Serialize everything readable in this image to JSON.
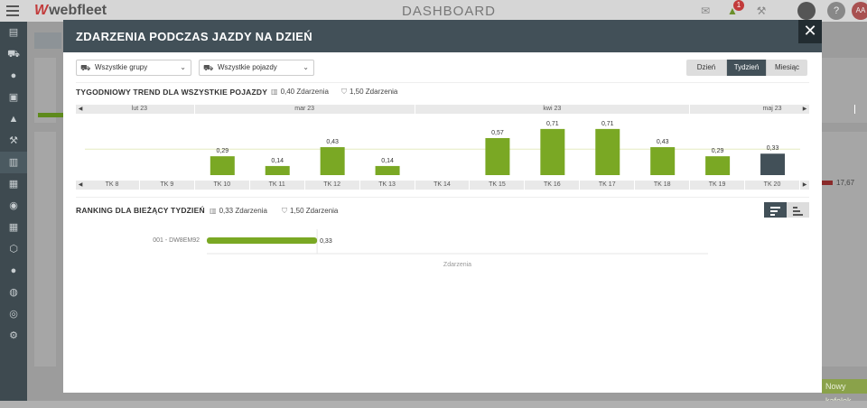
{
  "app": {
    "logo_text": "webfleet",
    "title": "DASHBOARD",
    "alert_count": "1",
    "avatar_initials": "AA",
    "help_label": "?"
  },
  "background": {
    "values": {
      "bg_val": "17,67"
    },
    "buttons": {
      "add_tile": "Nowy kafelek"
    }
  },
  "modal": {
    "title": "ZDARZENIA PODCZAS JAZDY NA DZIEŃ",
    "close_label": "✕",
    "filters": {
      "groups": "Wszystkie grupy",
      "vehicles": "Wszystkie pojazdy"
    },
    "period_tabs": [
      {
        "label": "Dzień",
        "active": false
      },
      {
        "label": "Tydzień",
        "active": true
      },
      {
        "label": "Miesiąc",
        "active": false
      }
    ],
    "trend": {
      "title": "TYGODNIOWY TREND DLA WSZYSTKIE POJAZDY",
      "stat_average": "0,40 Zdarzenia",
      "stat_threshold": "1,50 Zdarzenia",
      "months": [
        {
          "label": "lut 23",
          "weeks": 2
        },
        {
          "label": "mar 23",
          "weeks": 4
        },
        {
          "label": "kwi 23",
          "weeks": 5
        },
        {
          "label": "maj 23",
          "weeks": 3
        }
      ]
    },
    "ranking": {
      "title": "RANKING DLA BIEŻĄCY TYDZIEŃ",
      "stat_average": "0,33 Zdarzenia",
      "stat_threshold": "1,50 Zdarzenia",
      "xlabel": "Zdarzenia"
    }
  },
  "colors": {
    "accent_green": "#7aa824",
    "current_dark": "#425058",
    "average_line": "#e6ecc0"
  },
  "chart_data": [
    {
      "type": "bar",
      "title": "TYGODNIOWY TREND DLA WSZYSTKIE POJAZDY",
      "categories": [
        "TK 8",
        "TK 9",
        "TK 10",
        "TK 11",
        "TK 12",
        "TK 13",
        "TK 14",
        "TK 15",
        "TK 16",
        "TK 17",
        "TK 18",
        "TK 19",
        "TK 20"
      ],
      "values": [
        null,
        null,
        0.29,
        0.14,
        0.43,
        0.14,
        null,
        0.57,
        0.71,
        0.71,
        0.43,
        0.29,
        0.33
      ],
      "labels": [
        "",
        "",
        "0,29",
        "0,14",
        "0,43",
        "0,14",
        "",
        "0,57",
        "0,71",
        "0,71",
        "0,43",
        "0,29",
        "0,33"
      ],
      "average": 0.4,
      "highlight_last": true,
      "ylim": [
        0,
        0.75
      ],
      "grid": false
    },
    {
      "type": "bar",
      "orientation": "horizontal",
      "title": "RANKING DLA BIEŻĄCY TYDZIEŃ",
      "categories": [
        "001 - DW8EM92"
      ],
      "values": [
        0.33
      ],
      "labels": [
        "0,33"
      ],
      "xlabel": "Zdarzenia",
      "xlim": [
        0,
        1.5
      ]
    }
  ]
}
